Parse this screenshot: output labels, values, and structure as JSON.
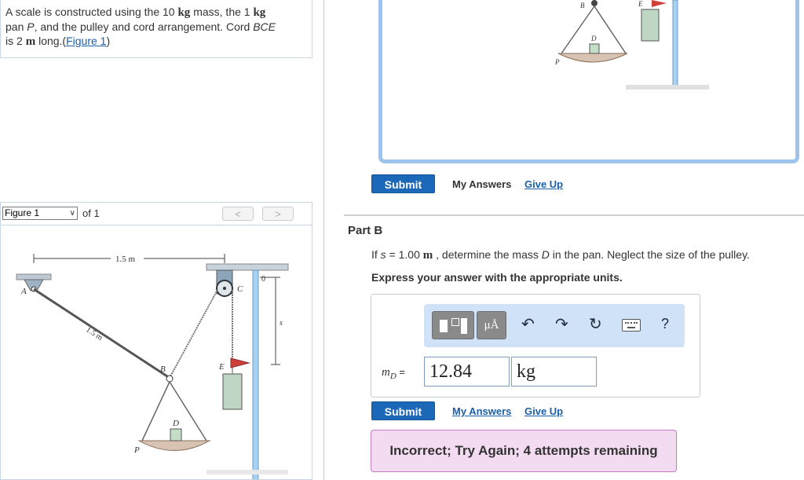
{
  "problem": {
    "text_a": "A scale is constructed using the 10 ",
    "kg1": "kg",
    "text_b": " mass, the 1 ",
    "kg2": "kg",
    "text_c": " pan ",
    "p": "P",
    "text_d": ", and the pulley and cord arrangement. Cord ",
    "bce": "BCE",
    "text_e": " is 2 ",
    "m": "m",
    "text_f": " long.(",
    "figure_link": "Figure 1",
    "text_g": ")"
  },
  "figure_nav": {
    "select_value": "Figure 1",
    "of_label": "of 1",
    "prev": "<",
    "next": ">"
  },
  "figure": {
    "dim_top": "1.5 m",
    "dim_diag": "1.5 m",
    "label_a": "A",
    "label_b": "B",
    "label_c": "C",
    "label_d": "D",
    "label_e": "E",
    "label_p": "P",
    "label_s": "s",
    "label_0": "0"
  },
  "part_a_actions": {
    "submit": "Submit",
    "my_answers": "My Answers",
    "give_up": "Give Up"
  },
  "part_b": {
    "title": "Part B",
    "q_a": "If ",
    "q_s": "s",
    "q_b": " = 1.00 ",
    "q_m": "m",
    "q_c": " , determine the mass ",
    "q_d": "D",
    "q_e": " in the pan. Neglect the size of the pulley.",
    "express": "Express your answer with the appropriate units.",
    "toolbar": {
      "templates_icon": "templates-icon",
      "symbols_label": "μÅ",
      "undo_icon": "undo-icon",
      "redo_icon": "redo-icon",
      "reset_icon": "reset-icon",
      "keyboard_icon": "keyboard-icon",
      "help_label": "?"
    },
    "answer_label": "m",
    "answer_sub": "D",
    "answer_eq": " =",
    "value": "12.84",
    "units": "kg",
    "submit": "Submit",
    "my_answers": "My Answers",
    "give_up": "Give Up",
    "feedback": "Incorrect; Try Again; 4 attempts remaining"
  },
  "colors": {
    "accent": "#1b68b8",
    "panel_border": "#9ec4ec",
    "toolbar_bg": "#cfe2f8",
    "feedback_bg": "#f3dcf1",
    "feedback_border": "#c27ac0"
  }
}
